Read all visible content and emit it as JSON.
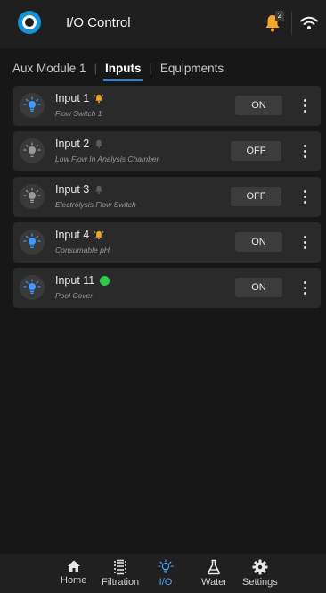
{
  "header": {
    "title": "I/O Control",
    "notification_count": "2",
    "icons": [
      "app-logo",
      "bell-icon",
      "wifi-icon"
    ]
  },
  "tabs": [
    {
      "label": "Aux Module 1",
      "active": false
    },
    {
      "label": "Inputs",
      "active": true
    },
    {
      "label": "Equipments",
      "active": false
    }
  ],
  "inputs": [
    {
      "name": "Input 1",
      "description": "Flow Switch 1",
      "state": "ON",
      "status": "alarm-orange",
      "light": "on"
    },
    {
      "name": "Input 2",
      "description": "Low Flow In Analysis Chamber",
      "state": "OFF",
      "status": "alarm-gray",
      "light": "off"
    },
    {
      "name": "Input 3",
      "description": "Electrolysis Flow Switch",
      "state": "OFF",
      "status": "alarm-gray",
      "light": "off"
    },
    {
      "name": "Input 4",
      "description": "Consumable pH",
      "state": "ON",
      "status": "alarm-orange",
      "light": "on"
    },
    {
      "name": "Input 11",
      "description": "Pool Cover",
      "state": "ON",
      "status": "dot-green",
      "light": "on"
    }
  ],
  "bottom_nav": [
    {
      "label": "Home",
      "icon": "home-icon",
      "active": false
    },
    {
      "label": "Filtration",
      "icon": "filtration-icon",
      "active": false
    },
    {
      "label": "I/O",
      "icon": "bulb-icon",
      "active": true
    },
    {
      "label": "Water",
      "icon": "flask-icon",
      "active": false
    },
    {
      "label": "Settings",
      "icon": "gear-icon",
      "active": false
    }
  ],
  "colors": {
    "accent": "#1e88e5",
    "alarm_orange": "#f5a623",
    "alarm_gray": "#5a5a5a",
    "status_green": "#2ecc4b",
    "light_on": "#3d9bff",
    "light_off": "#9a9a9a"
  }
}
